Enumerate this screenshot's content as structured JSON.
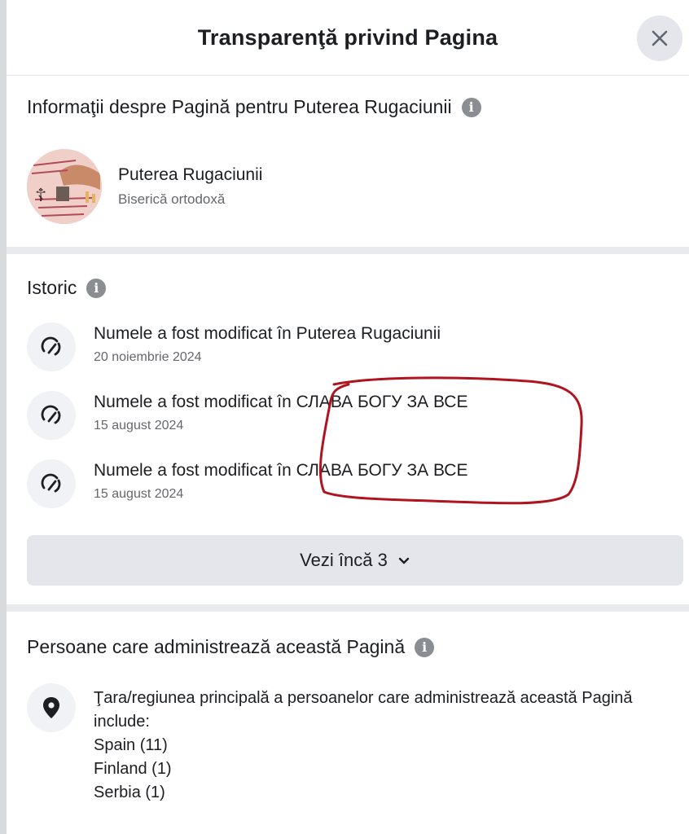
{
  "dialog": {
    "title": "Transparenţă privind Pagina",
    "close_icon": "close-icon"
  },
  "page_info": {
    "heading": "Informaţii despre Pagină pentru Puterea Rugaciunii",
    "page_name": "Puterea Rugaciunii",
    "category": "Biserică ortodoxă"
  },
  "history": {
    "heading": "Istoric",
    "items": [
      {
        "title": "Numele a fost modificat în Puterea Rugaciunii",
        "date": "20 noiembrie 2024",
        "icon": "name-change-icon"
      },
      {
        "title": "Numele a fost modificat în СЛАВА БОГУ ЗА ВСЕ",
        "date": "15 august 2024",
        "icon": "name-change-icon"
      },
      {
        "title": "Numele a fost modificat în СЛАВА БОГУ ЗА ВСЕ",
        "date": "15 august 2024",
        "icon": "name-change-icon"
      }
    ],
    "see_more_label": "Vezi încă 3",
    "annotation_color": "#b0151f"
  },
  "admins": {
    "heading": "Persoane care administrează această Pagină",
    "description": "Ţara/regiunea principală a persoanelor care administrează această Pagină include:",
    "countries": [
      "Spain (11)",
      "Finland (1)",
      "Serbia (1)"
    ],
    "icon": "location-pin-icon"
  },
  "colors": {
    "primary_text": "#1c1e21",
    "secondary_text": "#65676b",
    "button_bg": "#e4e6eb"
  }
}
